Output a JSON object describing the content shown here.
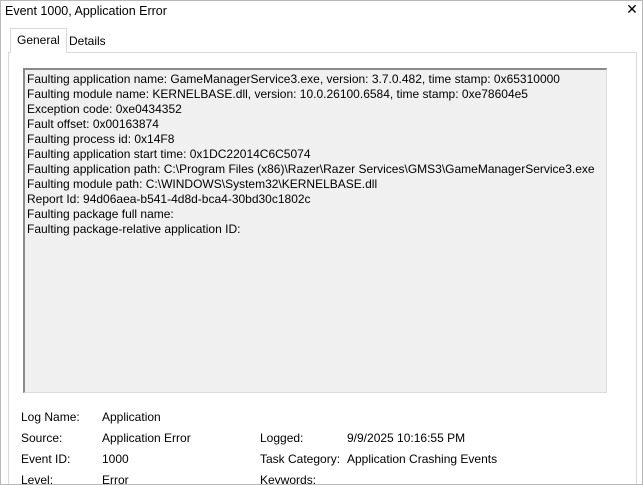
{
  "window": {
    "title": "Event 1000, Application Error",
    "close_glyph": "✕"
  },
  "tabs": [
    {
      "label": "General",
      "active": true
    },
    {
      "label": "Details",
      "active": false
    }
  ],
  "description": {
    "lines": [
      "Faulting application name: GameManagerService3.exe, version: 3.7.0.482, time stamp: 0x65310000",
      "Faulting module name: KERNELBASE.dll, version: 10.0.26100.6584, time stamp: 0xe78604e5",
      "Exception code: 0xe0434352",
      "Fault offset: 0x00163874",
      "Faulting process id: 0x14F8",
      "Faulting application start time: 0x1DC22014C6C5074",
      "Faulting application path: C:\\Program Files (x86)\\Razer\\Razer Services\\GMS3\\GameManagerService3.exe",
      "Faulting module path: C:\\WINDOWS\\System32\\KERNELBASE.dll",
      "Report Id: 94d06aea-b541-4d8d-bca4-30bd30c1802c",
      "Faulting package full name:",
      "Faulting package-relative application ID:"
    ]
  },
  "fields": {
    "log_name_label": "Log Name:",
    "log_name_value": "Application",
    "source_label": "Source:",
    "source_value": "Application Error",
    "logged_label": "Logged:",
    "logged_value": "9/9/2025 10:16:55 PM",
    "event_id_label": "Event ID:",
    "event_id_value": "1000",
    "task_category_label": "Task Category:",
    "task_category_value": "Application Crashing Events",
    "level_label": "Level:",
    "level_value": "Error",
    "keywords_label": "Keywords:",
    "keywords_value": ""
  }
}
